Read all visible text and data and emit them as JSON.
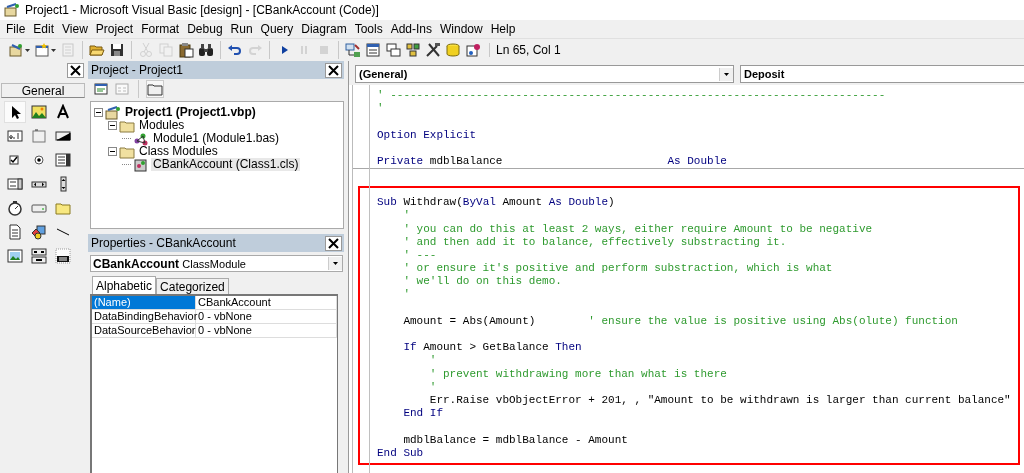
{
  "window": {
    "title": "Project1 - Microsoft Visual Basic [design] - [CBankAccount (Code)]"
  },
  "menu": [
    "File",
    "Edit",
    "View",
    "Project",
    "Format",
    "Debug",
    "Run",
    "Query",
    "Diagram",
    "Tools",
    "Add-Ins",
    "Window",
    "Help"
  ],
  "toolbar": {
    "buttons": [
      {
        "kind": "add-project",
        "dropdown": true,
        "disabled": false
      },
      {
        "kind": "add-form",
        "dropdown": true,
        "disabled": false
      },
      {
        "kind": "menu-editor",
        "dropdown": false,
        "disabled": true
      },
      {
        "kind": "separator"
      },
      {
        "kind": "open",
        "dropdown": false,
        "disabled": false
      },
      {
        "kind": "save",
        "dropdown": false,
        "disabled": false
      },
      {
        "kind": "separator"
      },
      {
        "kind": "cut",
        "dropdown": false,
        "disabled": true
      },
      {
        "kind": "copy",
        "dropdown": false,
        "disabled": true
      },
      {
        "kind": "paste",
        "dropdown": false,
        "disabled": false
      },
      {
        "kind": "find",
        "dropdown": false,
        "disabled": false
      },
      {
        "kind": "separator"
      },
      {
        "kind": "undo",
        "dropdown": false,
        "disabled": false
      },
      {
        "kind": "redo",
        "dropdown": false,
        "disabled": true
      },
      {
        "kind": "separator"
      },
      {
        "kind": "run",
        "dropdown": false,
        "disabled": false
      },
      {
        "kind": "pause",
        "dropdown": false,
        "disabled": true
      },
      {
        "kind": "stop",
        "dropdown": false,
        "disabled": true
      },
      {
        "kind": "separator"
      },
      {
        "kind": "explorer",
        "dropdown": false,
        "disabled": false
      },
      {
        "kind": "properties",
        "dropdown": false,
        "disabled": false
      },
      {
        "kind": "layout",
        "dropdown": false,
        "disabled": false
      },
      {
        "kind": "browser",
        "dropdown": false,
        "disabled": false
      },
      {
        "kind": "tools",
        "dropdown": false,
        "disabled": false
      },
      {
        "kind": "data",
        "dropdown": false,
        "disabled": false
      },
      {
        "kind": "component",
        "dropdown": false,
        "disabled": false
      }
    ],
    "position": "Ln 65, Col 1"
  },
  "toolbox": {
    "tab": "General",
    "tools": [
      {
        "kind": "pointer",
        "selected": true
      },
      {
        "kind": "picture",
        "selected": false
      },
      {
        "kind": "label",
        "selected": false
      },
      {
        "kind": "textbox",
        "selected": false
      },
      {
        "kind": "frame",
        "selected": false
      },
      {
        "kind": "command",
        "selected": false
      },
      {
        "kind": "checkbox",
        "selected": false
      },
      {
        "kind": "option",
        "selected": false
      },
      {
        "kind": "combo",
        "selected": false
      },
      {
        "kind": "list",
        "selected": false
      },
      {
        "kind": "hscroll",
        "selected": false
      },
      {
        "kind": "vscroll",
        "selected": false
      },
      {
        "kind": "timer",
        "selected": false
      },
      {
        "kind": "drive",
        "selected": false
      },
      {
        "kind": "dir",
        "selected": false
      },
      {
        "kind": "file",
        "selected": false
      },
      {
        "kind": "shape",
        "selected": false
      },
      {
        "kind": "line",
        "selected": false
      },
      {
        "kind": "image",
        "selected": false
      },
      {
        "kind": "data",
        "selected": false
      },
      {
        "kind": "ole",
        "selected": false
      }
    ]
  },
  "project": {
    "title": "Project - Project1",
    "tree": [
      {
        "label": "Project1 (Project1.vbp)",
        "kind": "project",
        "expanded": true,
        "selected": false,
        "children": [
          {
            "label": "Modules",
            "kind": "folder",
            "expanded": true,
            "selected": false,
            "children": [
              {
                "label": "Module1 (Module1.bas)",
                "kind": "module",
                "selected": false
              }
            ]
          },
          {
            "label": "Class Modules",
            "kind": "folder",
            "expanded": true,
            "selected": false,
            "children": [
              {
                "label": "CBankAccount (Class1.cls)",
                "kind": "class",
                "selected": true
              }
            ]
          }
        ]
      }
    ]
  },
  "properties": {
    "title": "Properties - CBankAccount",
    "object": {
      "name": "CBankAccount",
      "type": "ClassModule"
    },
    "tabs": [
      {
        "label": "Alphabetic",
        "selected": true
      },
      {
        "label": "Categorized",
        "selected": false
      }
    ],
    "rows": [
      {
        "name": "(Name)",
        "value": "CBankAccount",
        "selected": true
      },
      {
        "name": "DataBindingBehavior",
        "value": "0 - vbNone",
        "selected": false
      },
      {
        "name": "DataSourceBehavior",
        "value": "0 - vbNone",
        "selected": false
      }
    ]
  },
  "code": {
    "object": "(General)",
    "procedure": "Deposit",
    "blocks": [
      {
        "highlighted": false,
        "lines": [
          {
            "kind": "code",
            "segments": [
              {
                "kind": "comment",
                "text": "' ---------------------------------------------------------------------------"
              }
            ]
          },
          {
            "kind": "code",
            "segments": [
              {
                "kind": "comment",
                "text": "'"
              }
            ]
          },
          {
            "kind": "blank"
          },
          {
            "kind": "code",
            "segments": [
              {
                "kind": "keyword",
                "text": "Option Explicit"
              }
            ]
          },
          {
            "kind": "blank"
          },
          {
            "kind": "code",
            "segments": [
              {
                "kind": "keyword",
                "text": "Private"
              },
              {
                "kind": "plain",
                "text": " mdblBalance                         "
              },
              {
                "kind": "keyword",
                "text": "As Double"
              }
            ]
          }
        ]
      },
      {
        "highlighted": true,
        "lines": [
          {
            "kind": "code",
            "segments": [
              {
                "kind": "keyword",
                "text": "Sub"
              },
              {
                "kind": "plain",
                "text": " Withdraw("
              },
              {
                "kind": "keyword",
                "text": "ByVal"
              },
              {
                "kind": "plain",
                "text": " Amount "
              },
              {
                "kind": "keyword",
                "text": "As Double"
              },
              {
                "kind": "plain",
                "text": ")"
              }
            ]
          },
          {
            "kind": "code",
            "segments": [
              {
                "kind": "comment",
                "text": "    '"
              }
            ]
          },
          {
            "kind": "code",
            "segments": [
              {
                "kind": "comment",
                "text": "    ' you can do this at least 2 ways, either require Amount to be negative"
              }
            ]
          },
          {
            "kind": "code",
            "segments": [
              {
                "kind": "comment",
                "text": "    ' and then add it to balance, effectively substracting it."
              }
            ]
          },
          {
            "kind": "code",
            "segments": [
              {
                "kind": "comment",
                "text": "    ' ---"
              }
            ]
          },
          {
            "kind": "code",
            "segments": [
              {
                "kind": "comment",
                "text": "    ' or ensure it's positive and perform substraction, which is what"
              }
            ]
          },
          {
            "kind": "code",
            "segments": [
              {
                "kind": "comment",
                "text": "    ' we'll do on this demo."
              }
            ]
          },
          {
            "kind": "code",
            "segments": [
              {
                "kind": "comment",
                "text": "    '"
              }
            ]
          },
          {
            "kind": "blank"
          },
          {
            "kind": "code",
            "segments": [
              {
                "kind": "plain",
                "text": "    Amount = Abs(Amount)        "
              },
              {
                "kind": "comment",
                "text": "' ensure the value is positive using Abs(olute) function"
              }
            ]
          },
          {
            "kind": "blank"
          },
          {
            "kind": "code",
            "segments": [
              {
                "kind": "keyword",
                "text": "    If"
              },
              {
                "kind": "plain",
                "text": " Amount > GetBalance "
              },
              {
                "kind": "keyword",
                "text": "Then"
              }
            ]
          },
          {
            "kind": "code",
            "segments": [
              {
                "kind": "comment",
                "text": "        '"
              }
            ]
          },
          {
            "kind": "code",
            "segments": [
              {
                "kind": "comment",
                "text": "        ' prevent withdrawing more than what is there"
              }
            ]
          },
          {
            "kind": "code",
            "segments": [
              {
                "kind": "comment",
                "text": "        '"
              }
            ]
          },
          {
            "kind": "code",
            "segments": [
              {
                "kind": "plain",
                "text": "        Err.Raise vbObjectError + 201, , \"Amount to be withdrawn is larger than current balance\""
              }
            ]
          },
          {
            "kind": "code",
            "segments": [
              {
                "kind": "keyword",
                "text": "    End If"
              }
            ]
          },
          {
            "kind": "blank"
          },
          {
            "kind": "code",
            "segments": [
              {
                "kind": "plain",
                "text": "    mdblBalance = mdblBalance - Amount"
              }
            ]
          },
          {
            "kind": "code",
            "segments": [
              {
                "kind": "keyword",
                "text": "End Sub"
              }
            ]
          }
        ]
      }
    ]
  }
}
